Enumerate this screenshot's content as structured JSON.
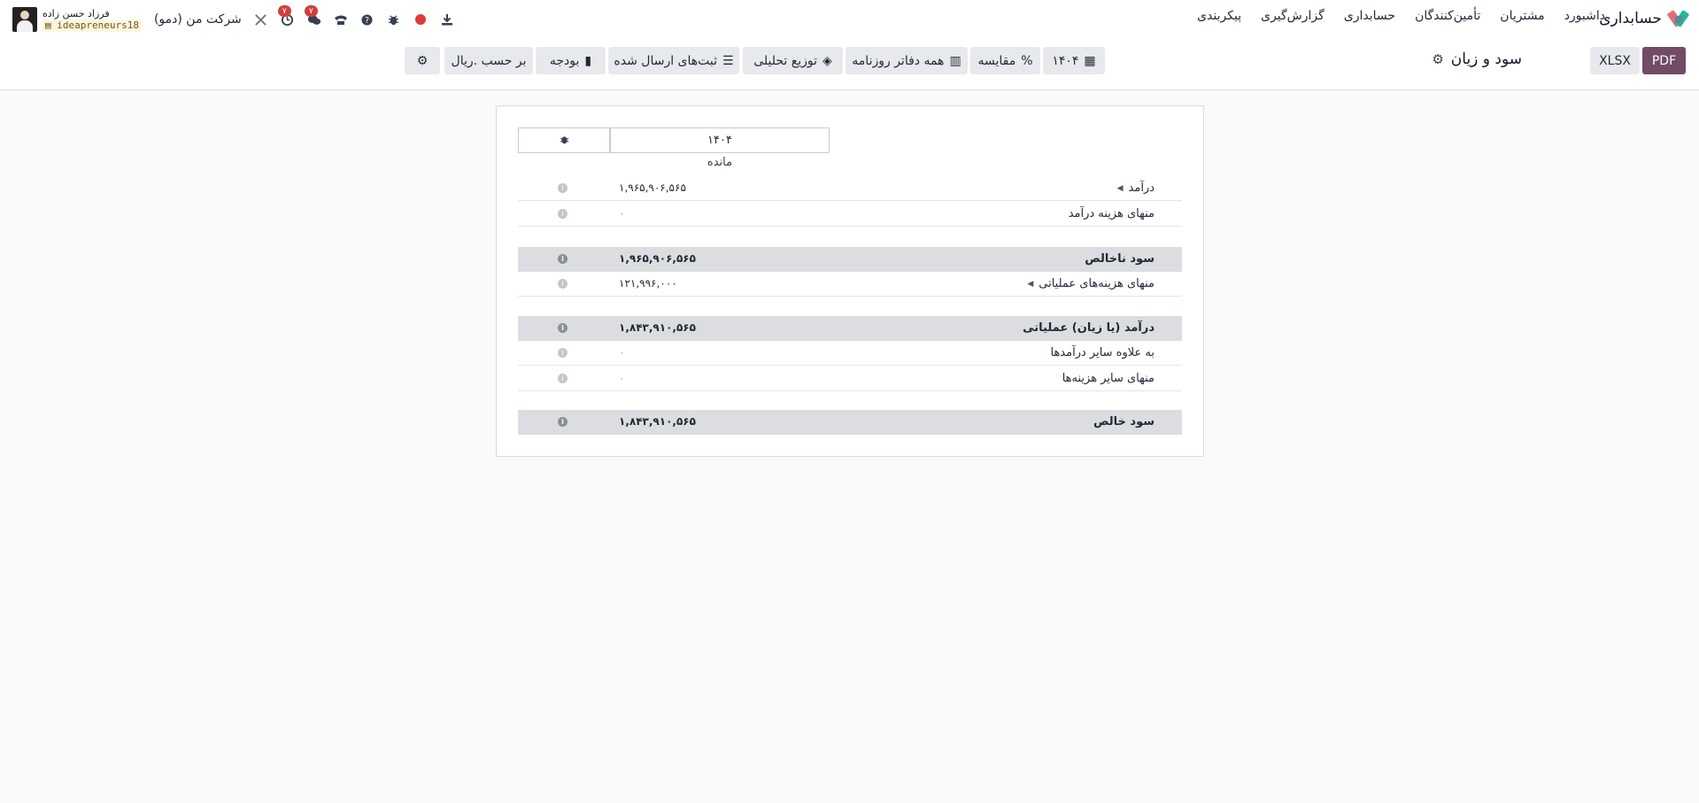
{
  "navbar": {
    "brand": "حسابداری",
    "menu": [
      "داشبورد",
      "مشتریان",
      "تأمین‌کنندگان",
      "حسابداری",
      "گزارش‌گیری",
      "پیکربندی"
    ],
    "user_name": "فرزاد حسن زاده",
    "database": "ideapreneurs18",
    "company": "شرکت من (دمو)",
    "activity_count": "۷",
    "messages_count": "۷"
  },
  "control": {
    "title": "سود و زیان",
    "pdf": "PDF",
    "xlsx": "XLSX",
    "filters": {
      "period": "۱۴۰۴",
      "comparison": "مقایسه",
      "journals": "همه دفاتر روزنامه",
      "analytic": "توزیع تحلیلی",
      "posted": "ثبت‌های ارسال شده",
      "budget": "بودجه",
      "currency": "بر حسب .ریال"
    }
  },
  "report": {
    "column_header": "۱۴۰۴",
    "sub_header": "مانده",
    "rows": [
      {
        "label": "درآمد",
        "value": "۱,۹۶۵,۹۰۶,۵۶۵",
        "type": "line",
        "expandable": true
      },
      {
        "label": "منهای هزینه درآمد",
        "value": "۰",
        "type": "line",
        "expandable": false
      },
      {
        "label": "سود ناخالص",
        "value": "۱,۹۶۵,۹۰۶,۵۶۵",
        "type": "total",
        "expandable": false
      },
      {
        "label": "منهای هزینه‌های عملیاتی",
        "value": "۱۲۱,۹۹۶,۰۰۰",
        "type": "line",
        "expandable": true
      },
      {
        "label": "درآمد (یا زیان) عملیاتی",
        "value": "۱,۸۴۳,۹۱۰,۵۶۵",
        "type": "total",
        "expandable": false
      },
      {
        "label": "به علاوه سایر درآمدها",
        "value": "۰",
        "type": "line",
        "expandable": false
      },
      {
        "label": "منهای سایر هزینه‌ها",
        "value": "۰",
        "type": "line",
        "expandable": false
      },
      {
        "label": "سود خالص",
        "value": "۱,۸۴۳,۹۱۰,۵۶۵",
        "type": "total",
        "expandable": false
      }
    ]
  },
  "colors": {
    "primary": "#714b67",
    "badge": "#d23f3a",
    "total_row": "#dcdde0"
  }
}
